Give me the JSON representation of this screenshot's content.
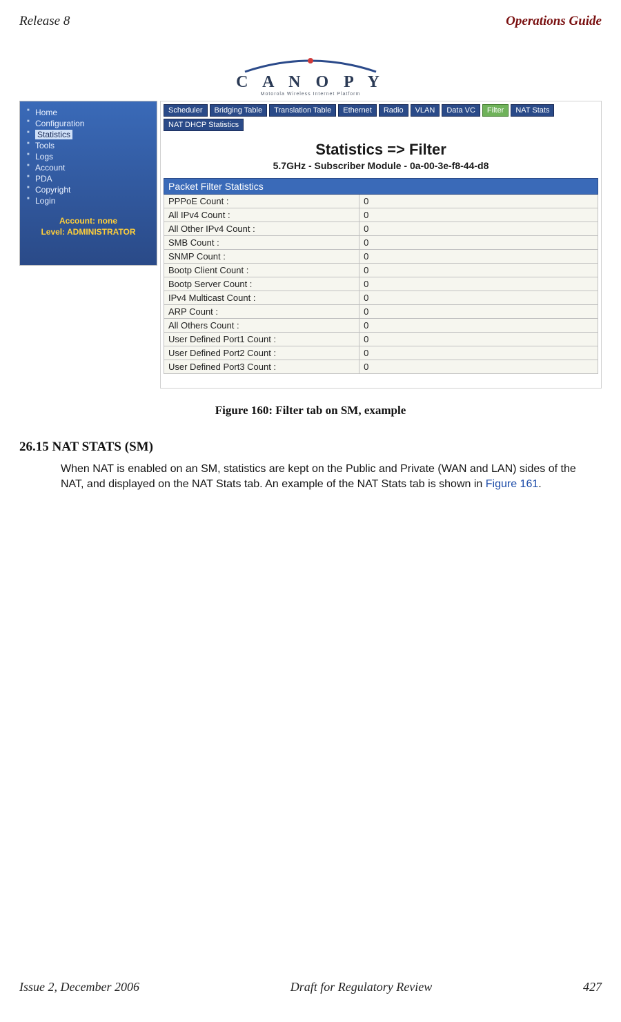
{
  "doc": {
    "header_left": "Release 8",
    "header_right": "Operations Guide",
    "footer_left": "Issue 2, December 2006",
    "footer_center": "Draft for Regulatory Review",
    "footer_right": "427"
  },
  "logo": {
    "text": "C A N O P Y",
    "subtext": "Motorola  Wireless  Internet  Platform"
  },
  "sidebar": {
    "items": [
      {
        "label": "Home",
        "active": false
      },
      {
        "label": "Configuration",
        "active": false
      },
      {
        "label": "Statistics",
        "active": true
      },
      {
        "label": "Tools",
        "active": false
      },
      {
        "label": "Logs",
        "active": false
      },
      {
        "label": "Account",
        "active": false
      },
      {
        "label": "PDA",
        "active": false
      },
      {
        "label": "Copyright",
        "active": false
      },
      {
        "label": "Login",
        "active": false
      }
    ],
    "account_line1": "Account: none",
    "account_line2": "Level: ADMINISTRATOR"
  },
  "tabs": [
    {
      "label": "Scheduler",
      "active": false
    },
    {
      "label": "Bridging Table",
      "active": false
    },
    {
      "label": "Translation Table",
      "active": false
    },
    {
      "label": "Ethernet",
      "active": false
    },
    {
      "label": "Radio",
      "active": false
    },
    {
      "label": "VLAN",
      "active": false
    },
    {
      "label": "Data VC",
      "active": false
    },
    {
      "label": "Filter",
      "active": true
    },
    {
      "label": "NAT Stats",
      "active": false
    },
    {
      "label": "NAT DHCP Statistics",
      "active": false
    }
  ],
  "panel": {
    "title": "Statistics => Filter",
    "subtitle": "5.7GHz - Subscriber Module - 0a-00-3e-f8-44-d8",
    "table_header": "Packet Filter Statistics",
    "rows": [
      {
        "label": "PPPoE Count :",
        "value": "0"
      },
      {
        "label": "All IPv4 Count :",
        "value": "0"
      },
      {
        "label": "All Other IPv4 Count :",
        "value": "0"
      },
      {
        "label": "SMB Count :",
        "value": "0"
      },
      {
        "label": "SNMP Count :",
        "value": "0"
      },
      {
        "label": "Bootp Client Count :",
        "value": "0"
      },
      {
        "label": "Bootp Server Count :",
        "value": "0"
      },
      {
        "label": "IPv4 Multicast Count :",
        "value": "0"
      },
      {
        "label": "ARP Count :",
        "value": "0"
      },
      {
        "label": "All Others Count :",
        "value": "0"
      },
      {
        "label": "User Defined Port1 Count :",
        "value": "0"
      },
      {
        "label": "User Defined Port2 Count :",
        "value": "0"
      },
      {
        "label": "User Defined Port3 Count :",
        "value": "0"
      }
    ]
  },
  "caption": "Figure 160: Filter tab on SM, example",
  "section": {
    "heading": "26.15  NAT STATS (SM)",
    "body_pre": "When NAT is enabled on an SM, statistics are kept on the Public and Private (WAN and LAN) sides of the NAT, and displayed on the NAT Stats tab. An example of the NAT Stats tab is shown in ",
    "xref": "Figure 161",
    "body_post": "."
  }
}
